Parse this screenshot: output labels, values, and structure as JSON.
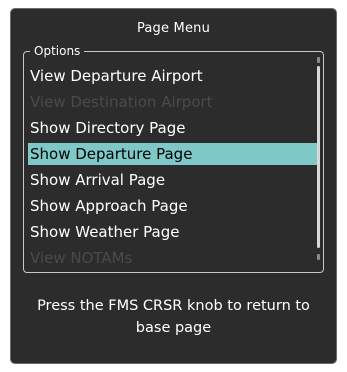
{
  "window": {
    "title": "Page Menu"
  },
  "options": {
    "label": "Options",
    "items": [
      {
        "label": "View Departure Airport",
        "state": "enabled"
      },
      {
        "label": "View Destination Airport",
        "state": "disabled"
      },
      {
        "label": "Show Directory Page",
        "state": "enabled"
      },
      {
        "label": "Show Departure Page",
        "state": "selected"
      },
      {
        "label": "Show Arrival Page",
        "state": "enabled"
      },
      {
        "label": "Show Approach Page",
        "state": "enabled"
      },
      {
        "label": "Show Weather Page",
        "state": "enabled"
      },
      {
        "label": "View NOTAMs",
        "state": "disabled"
      }
    ]
  },
  "footer": {
    "line1": "Press the FMS CRSR knob to return to",
    "line2": "base page"
  },
  "colors": {
    "background": "#2c2c2c",
    "highlight": "#7ec8c8",
    "disabled_text": "#4a4a4a",
    "text": "#ffffff"
  }
}
